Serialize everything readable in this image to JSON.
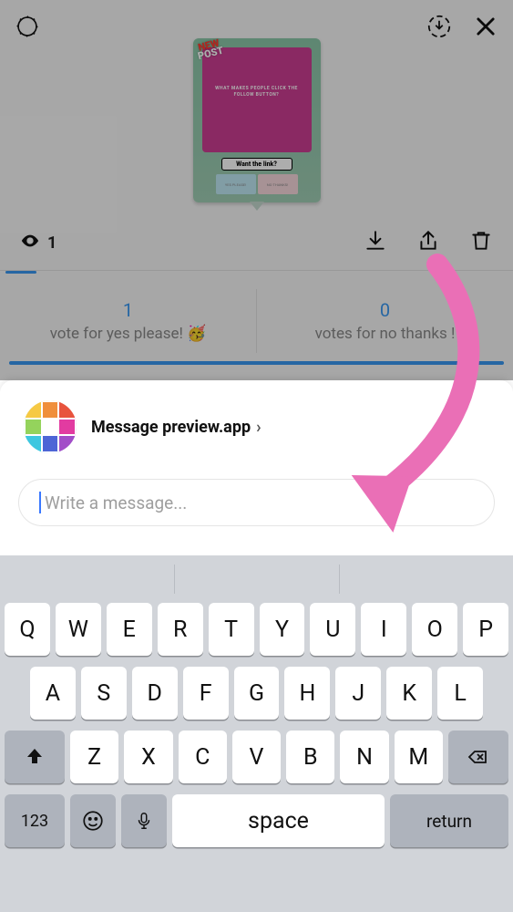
{
  "story": {
    "badge_line1": "NEW",
    "badge_line2": "POST",
    "card_text": "WHAT MAKES PEOPLE CLICK THE FOLLOW BUTTON?",
    "prompt": "Want the link?",
    "poll_option_a": "YES PLEASE!",
    "poll_option_b": "NO THANKS!"
  },
  "stats": {
    "views": "1"
  },
  "votes": {
    "yes_count": "1",
    "yes_label": "vote for yes please! 🥳",
    "no_count": "0",
    "no_label": "votes for no thanks !"
  },
  "panel": {
    "recipient": "Message preview.app",
    "chevron": "›",
    "input_placeholder": "Write a message..."
  },
  "keyboard": {
    "row1": [
      "Q",
      "W",
      "E",
      "R",
      "T",
      "Y",
      "U",
      "I",
      "O",
      "P"
    ],
    "row2": [
      "A",
      "S",
      "D",
      "F",
      "G",
      "H",
      "J",
      "K",
      "L"
    ],
    "row3": [
      "Z",
      "X",
      "C",
      "V",
      "B",
      "N",
      "M"
    ],
    "numbers": "123",
    "space": "space",
    "return": "return"
  },
  "colors": {
    "accent_blue": "#3897f0",
    "arrow_pink": "#ea6fb6"
  }
}
